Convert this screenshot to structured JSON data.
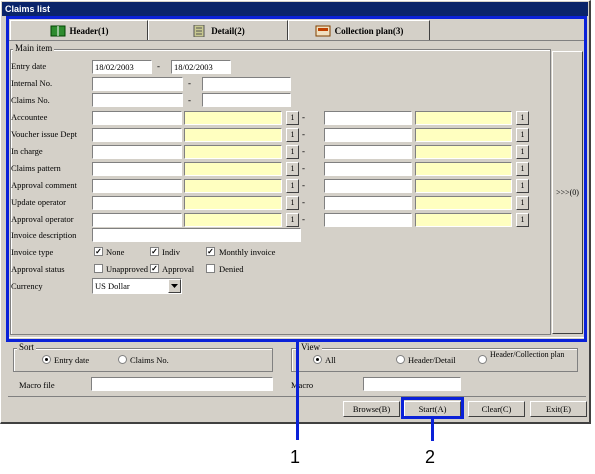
{
  "window": {
    "title": "Claims list"
  },
  "tabs": [
    {
      "label": "Header(1)",
      "icon": "book-icon"
    },
    {
      "label": "Detail(2)",
      "icon": "document-icon"
    },
    {
      "label": "Collection plan(3)",
      "icon": "calendar-icon"
    }
  ],
  "main_item": {
    "group_label": "Main item",
    "entry_date": {
      "label": "Entry date",
      "from": "18/02/2003",
      "dash": "-",
      "to": "18/02/2003"
    },
    "internal_no": {
      "label": "Internal No.",
      "dash": "-"
    },
    "claims_no": {
      "label": "Claims No.",
      "dash": "-"
    },
    "code_rows": [
      {
        "label": "Accountee"
      },
      {
        "label": "Voucher issue Dept"
      },
      {
        "label": "In charge"
      },
      {
        "label": "Claims pattern"
      },
      {
        "label": "Approval comment"
      },
      {
        "label": "Update operator"
      },
      {
        "label": "Approval operator"
      }
    ],
    "lookup_button_label": "1",
    "range_dash": "-",
    "invoice_description": {
      "label": "Invoice description"
    },
    "invoice_type": {
      "label": "Invoice type",
      "options": [
        {
          "label": "None",
          "checked": true
        },
        {
          "label": "Indiv",
          "checked": true
        },
        {
          "label": "Monthly invoice",
          "checked": true
        }
      ]
    },
    "approval_status": {
      "label": "Approval status",
      "options": [
        {
          "label": "Unapproved",
          "checked": false
        },
        {
          "label": "Approval",
          "checked": true
        },
        {
          "label": "Denied",
          "checked": false
        }
      ]
    },
    "currency": {
      "label": "Currency",
      "value": "US Dollar"
    },
    "more_button": ">>>(0)"
  },
  "sort": {
    "label": "Sort",
    "options": [
      {
        "label": "Entry date",
        "selected": true
      },
      {
        "label": "Claims No.",
        "selected": false
      }
    ]
  },
  "view": {
    "label": "View",
    "options": [
      {
        "label": "All",
        "selected": true
      },
      {
        "label": "Header/Detail",
        "selected": false
      },
      {
        "label": "Header/Collection plan",
        "selected": false
      }
    ]
  },
  "macro_file": {
    "label": "Macro file"
  },
  "macro": {
    "label": "Macro"
  },
  "buttons": {
    "browse": "Browse(B)",
    "start": "Start(A)",
    "clear": "Clear(C)",
    "exit": "Exit(E)"
  },
  "callouts": {
    "one": "1",
    "two": "2"
  },
  "colors": {
    "highlight": "#0a21d8",
    "title_bar": "#0a246a",
    "yellow_field": "#ffffc0"
  }
}
